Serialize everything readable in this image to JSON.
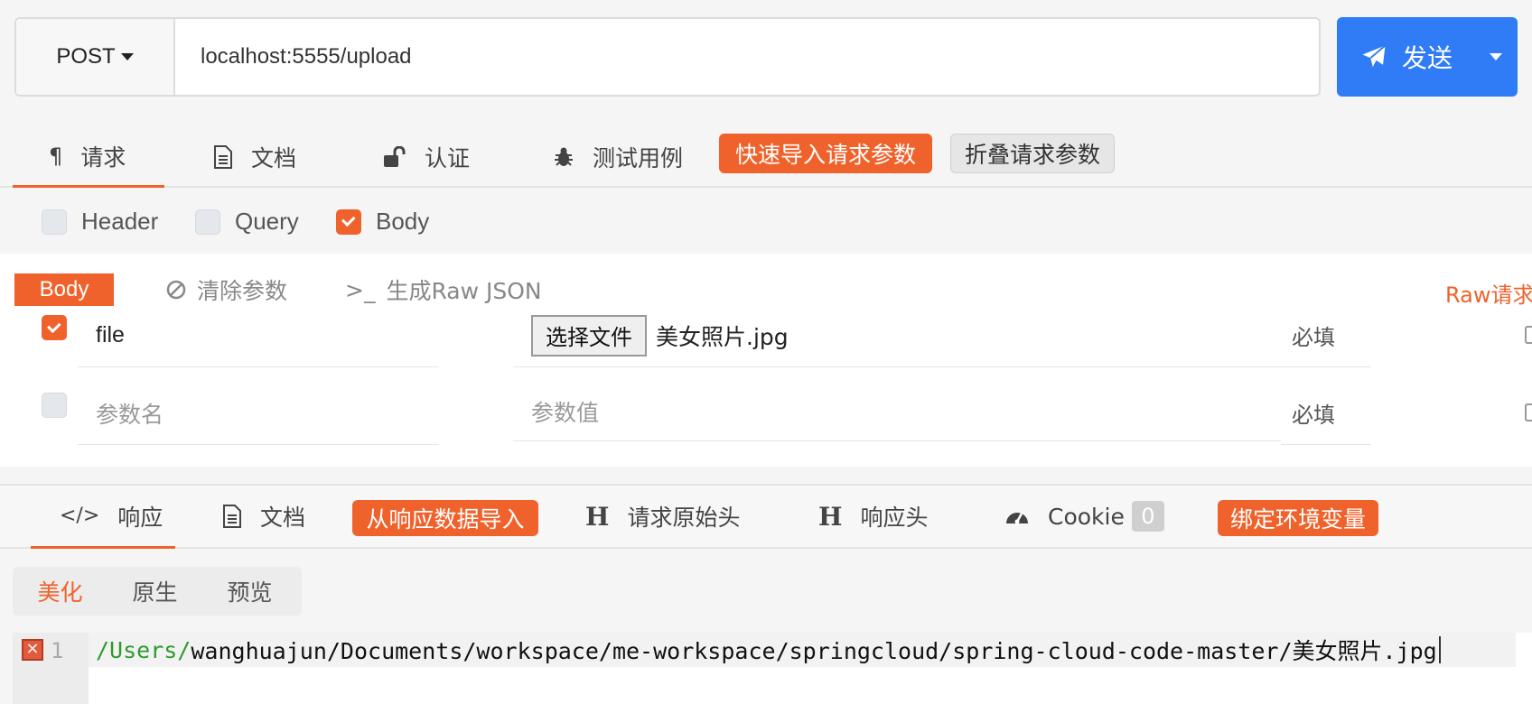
{
  "url_bar": {
    "method": "POST",
    "url": "localhost:5555/upload",
    "send_label": "发送"
  },
  "request_tabs": [
    {
      "label": "请求",
      "icon": "paragraph-icon",
      "active": true
    },
    {
      "label": "文档",
      "icon": "document-icon"
    },
    {
      "label": "认证",
      "icon": "unlock-icon"
    },
    {
      "label": "测试用例",
      "icon": "bug-icon"
    }
  ],
  "request_actions": {
    "quick_import": "快速导入请求参数",
    "collapse": "折叠请求参数"
  },
  "options": [
    {
      "label": "Header",
      "checked": false
    },
    {
      "label": "Query",
      "checked": false
    },
    {
      "label": "Body",
      "checked": true
    }
  ],
  "body": {
    "tag": "Body",
    "clear": "清除参数",
    "gen_raw": "生成Raw JSON",
    "raw_link": "Raw请求",
    "params": [
      {
        "checked": true,
        "name": "file",
        "file_button": "选择文件",
        "file_name": "美女照片.jpg",
        "required": "必填"
      },
      {
        "checked": false,
        "name_placeholder": "参数名",
        "value_placeholder": "参数值",
        "required": "必填"
      }
    ]
  },
  "response_tabs": [
    {
      "label": "响应",
      "icon": "code-icon",
      "active": true
    },
    {
      "label": "文档",
      "icon": "document-icon"
    },
    {
      "label": "从响应数据导入",
      "style": "orange"
    },
    {
      "label": "请求原始头",
      "icon": "heading-icon"
    },
    {
      "label": "响应头",
      "icon": "heading-icon"
    },
    {
      "label": "Cookie",
      "icon": "gauge-icon",
      "badge": "0"
    },
    {
      "label": "绑定环境变量",
      "style": "orange"
    }
  ],
  "views": [
    {
      "label": "美化",
      "active": true
    },
    {
      "label": "原生"
    },
    {
      "label": "预览"
    }
  ],
  "code": {
    "line_number": "1",
    "error_marker": "×",
    "path_prefix": "/Users/",
    "path_rest": "wanghuajun/Documents/workspace/me-workspace/springcloud/spring-cloud-code-master/美女照片.jpg"
  },
  "colors": {
    "accent": "#f0622b",
    "send": "#2f7cf6"
  }
}
